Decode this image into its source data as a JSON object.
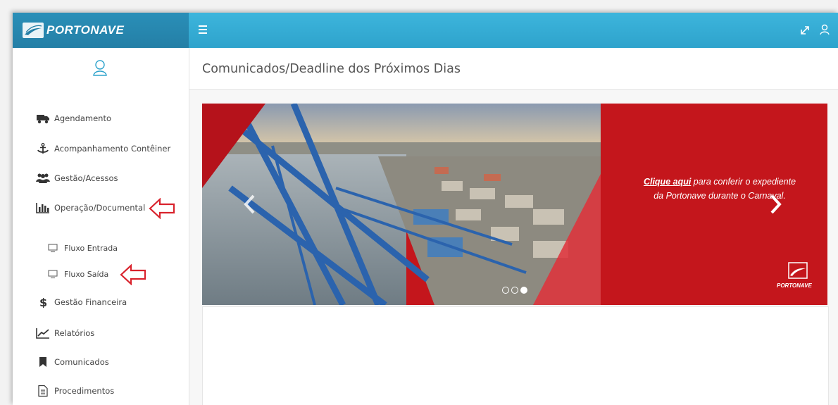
{
  "brand": {
    "name": "PORTONAVE"
  },
  "header": {
    "title": "Comunicados/Deadline dos Próximos Dias"
  },
  "sidebar": {
    "items": [
      {
        "label": "Agendamento",
        "icon": "truck-icon"
      },
      {
        "label": "Acompanhamento Contêiner",
        "icon": "anchor-icon"
      },
      {
        "label": "Gestão/Acessos",
        "icon": "users-icon"
      },
      {
        "label": "Operação/Documental",
        "icon": "bar-chart-icon"
      },
      {
        "label": "Fluxo Entrada",
        "icon": "monitor-icon"
      },
      {
        "label": "Fluxo Saída",
        "icon": "monitor-icon"
      },
      {
        "label": "Gestão Financeira",
        "icon": "dollar-icon"
      },
      {
        "label": "Relatórios",
        "icon": "line-chart-icon"
      },
      {
        "label": "Comunicados",
        "icon": "bookmark-icon"
      },
      {
        "label": "Procedimentos",
        "icon": "document-icon"
      }
    ]
  },
  "carousel": {
    "link_text": "Clique aqui",
    "text_rest": " para conferir o expediente",
    "text_line2": "da Portonave durante o Carnaval.",
    "logo_text": "PORTONAVE",
    "slides": 3,
    "active_slide": 3
  },
  "colors": {
    "topbar": "#2ea3cc",
    "brand_bg": "#247fa6",
    "panel_red": "#c4161c",
    "arrow_red": "#d9232d"
  }
}
